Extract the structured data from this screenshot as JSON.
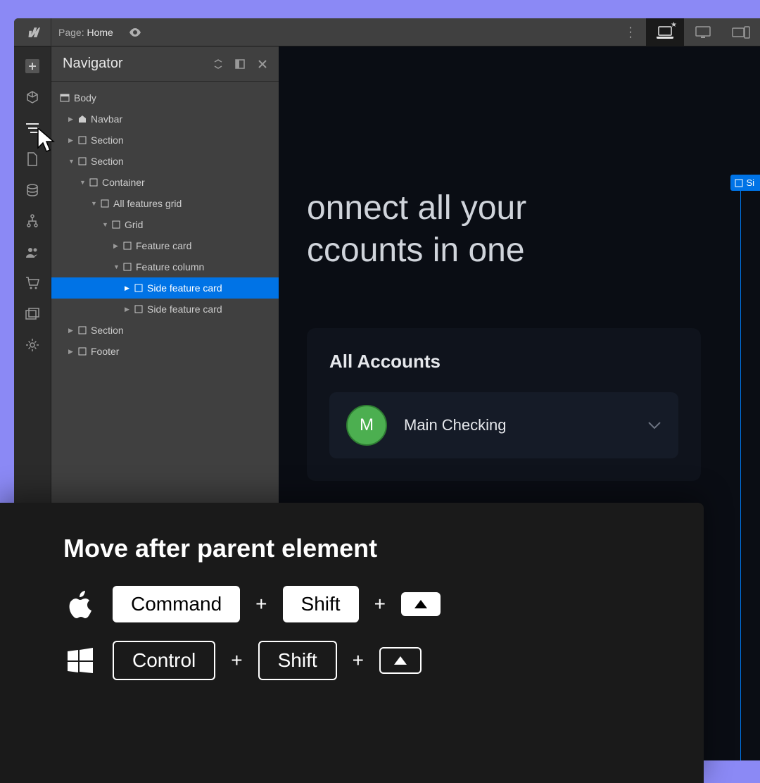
{
  "topbar": {
    "page_prefix": "Page:",
    "page_name": "Home"
  },
  "navigator": {
    "title": "Navigator"
  },
  "tree": {
    "r0": "Body",
    "r1": "Navbar",
    "r2": "Section",
    "r3": "Section",
    "r4": "Container",
    "r5": "All features grid",
    "r6": "Grid",
    "r7": "Feature card",
    "r8": "Feature column",
    "r9": "Side feature card",
    "r10": "Side feature card",
    "r11": "Section",
    "r12": "Footer"
  },
  "canvas": {
    "hero_line1": "onnect all your",
    "hero_line2": "ccounts in one",
    "accounts_title": "All Accounts",
    "avatar_letter": "M",
    "account_name": "Main Checking",
    "selection_tag_short": "Si"
  },
  "shortcut": {
    "title": "Move after parent element",
    "mac": {
      "k1": "Command",
      "k2": "Shift"
    },
    "win": {
      "k1": "Control",
      "k2": "Shift"
    },
    "plus": "+"
  }
}
